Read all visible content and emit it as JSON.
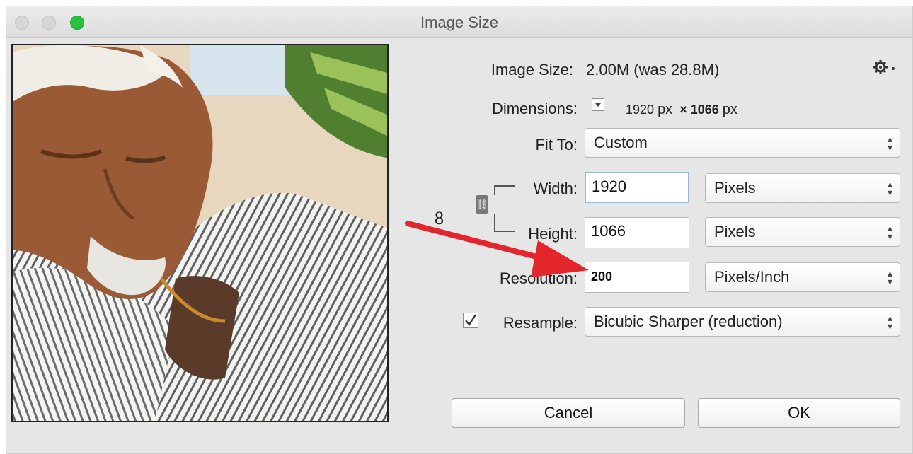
{
  "window": {
    "title": "Image Size"
  },
  "info": {
    "image_size_label": "Image Size:",
    "image_size_value": "2.00M (was 28.8M)",
    "dimensions_label": "Dimensions:",
    "dim_width": "1920",
    "dim_width_unit": "px",
    "dim_height": "× 1066",
    "dim_height_unit": "px"
  },
  "fit_to": {
    "label": "Fit To:",
    "value": "Custom"
  },
  "width": {
    "label": "Width:",
    "value": "1920",
    "unit": "Pixels"
  },
  "height": {
    "label": "Height:",
    "value": "1066",
    "unit": "Pixels"
  },
  "resolution": {
    "label": "Resolution:",
    "value": "200",
    "unit": "Pixels/Inch"
  },
  "resample": {
    "label": "Resample:",
    "checked": true,
    "value": "Bicubic Sharper (reduction)"
  },
  "buttons": {
    "cancel": "Cancel",
    "ok": "OK"
  },
  "annotation": {
    "step_number": "8",
    "arrow_color": "#e3262b"
  },
  "icons": {
    "gear": "gear-icon",
    "dimensions_toggle": "dropdown-toggle-icon",
    "chain": "link-chain-icon",
    "checkmark": "checkmark-icon",
    "select_arrows": "up-down-arrows-icon"
  }
}
